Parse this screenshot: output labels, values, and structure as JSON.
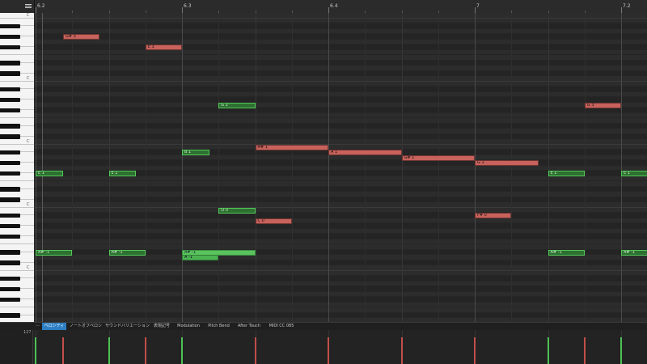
{
  "ruler": {
    "bars": [
      {
        "label": "6.2",
        "beat": 0
      },
      {
        "label": "6.3",
        "beat": 2
      },
      {
        "label": "6.4",
        "beat": 4
      },
      {
        "label": "7",
        "beat": 6
      },
      {
        "label": "7.2",
        "beat": 8
      }
    ]
  },
  "piano": {
    "octave_label": "C",
    "octave_labels": [
      {
        "text": "C",
        "pitch": 72
      },
      {
        "text": "C",
        "pitch": 60
      },
      {
        "text": "C",
        "pitch": 48
      },
      {
        "text": "C",
        "pitch": 36
      },
      {
        "text": "C",
        "pitch": 24
      }
    ]
  },
  "notes": [
    {
      "label": "G# 3",
      "pitch": 68,
      "start": 0.375,
      "length": 0.5,
      "color": "red"
    },
    {
      "label": "E 3",
      "pitch": 66,
      "start": 1.5,
      "length": 0.5,
      "color": "red"
    },
    {
      "label": "G 2",
      "pitch": 55,
      "start": 2.5,
      "length": 0.5,
      "color": "green"
    },
    {
      "label": "G 3",
      "pitch": 55,
      "start": 7.5,
      "length": 0.5,
      "color": "red"
    },
    {
      "label": "A# 1",
      "pitch": 47,
      "start": 3.0,
      "length": 1.0,
      "color": "red"
    },
    {
      "label": "A 1",
      "pitch": 46,
      "start": 4.0,
      "length": 1.0,
      "color": "red"
    },
    {
      "label": "G# 1",
      "pitch": 45,
      "start": 5.0,
      "length": 1.0,
      "color": "red"
    },
    {
      "label": "G 1",
      "pitch": 44,
      "start": 6.0,
      "length": 0.875,
      "color": "red"
    },
    {
      "label": "B 1",
      "pitch": 46,
      "start": 2.0,
      "length": 0.375,
      "color": "green"
    },
    {
      "label": "E 1",
      "pitch": 42,
      "start": 0.0,
      "length": 0.375,
      "color": "green"
    },
    {
      "label": "E 1",
      "pitch": 42,
      "start": 1.0,
      "length": 0.375,
      "color": "green"
    },
    {
      "label": "E 1",
      "pitch": 42,
      "start": 7.0,
      "length": 0.5,
      "color": "green"
    },
    {
      "label": "E 1",
      "pitch": 42,
      "start": 8.0,
      "length": 0.5,
      "color": "green"
    },
    {
      "label": "D 0",
      "pitch": 35,
      "start": 2.5,
      "length": 0.5,
      "color": "green"
    },
    {
      "label": "C 0",
      "pitch": 33,
      "start": 3.0,
      "length": 0.5,
      "color": "red"
    },
    {
      "label": "F# 0",
      "pitch": 34,
      "start": 6.0,
      "length": 0.5,
      "color": "red"
    },
    {
      "label": "A# -1",
      "pitch": 27,
      "start": 0.0,
      "length": 0.5,
      "color": "green"
    },
    {
      "label": "A# -1",
      "pitch": 27,
      "start": 1.0,
      "length": 0.5,
      "color": "green"
    },
    {
      "label": "A# -1",
      "pitch": 27,
      "start": 2.0,
      "length": 1.0,
      "color": "green",
      "style": "sel"
    },
    {
      "label": "A -1",
      "pitch": 26,
      "start": 2.0,
      "length": 0.5,
      "color": "green",
      "style": "solid"
    },
    {
      "label": "A# -1",
      "pitch": 27,
      "start": 7.0,
      "length": 0.5,
      "color": "green"
    },
    {
      "label": "A# -1",
      "pitch": 27,
      "start": 8.0,
      "length": 0.5,
      "color": "green"
    }
  ],
  "tabs": {
    "dash": "—",
    "items": [
      {
        "label": "ベロシティ",
        "active": true
      },
      {
        "label": "ノートオフベロシティ",
        "active": false
      },
      {
        "label": "サウンドバリエーション",
        "active": false
      },
      {
        "label": "表現記号",
        "active": false
      },
      {
        "label": "Modulation",
        "active": false
      },
      {
        "label": "Pitch Bend",
        "active": false
      },
      {
        "label": "After Touch",
        "active": false
      },
      {
        "label": "MIDI CC 085",
        "active": false
      }
    ]
  },
  "velocity": {
    "max_label": "127",
    "bars": [
      {
        "beat": 0.0,
        "value": 100,
        "color": "green"
      },
      {
        "beat": 0.375,
        "value": 100,
        "color": "red"
      },
      {
        "beat": 1.0,
        "value": 100,
        "color": "green"
      },
      {
        "beat": 1.5,
        "value": 100,
        "color": "red"
      },
      {
        "beat": 2.0,
        "value": 100,
        "color": "green"
      },
      {
        "beat": 3.0,
        "value": 100,
        "color": "red"
      },
      {
        "beat": 4.0,
        "value": 100,
        "color": "red"
      },
      {
        "beat": 5.0,
        "value": 100,
        "color": "red"
      },
      {
        "beat": 6.0,
        "value": 100,
        "color": "red"
      },
      {
        "beat": 7.0,
        "value": 100,
        "color": "green"
      },
      {
        "beat": 7.5,
        "value": 100,
        "color": "red"
      },
      {
        "beat": 8.0,
        "value": 100,
        "color": "green"
      }
    ]
  },
  "colors": {
    "note_red": "#c8625c",
    "note_green": "#2e7031",
    "tab_active": "#2d7fc3",
    "velocity_red": "#c24e4a"
  }
}
